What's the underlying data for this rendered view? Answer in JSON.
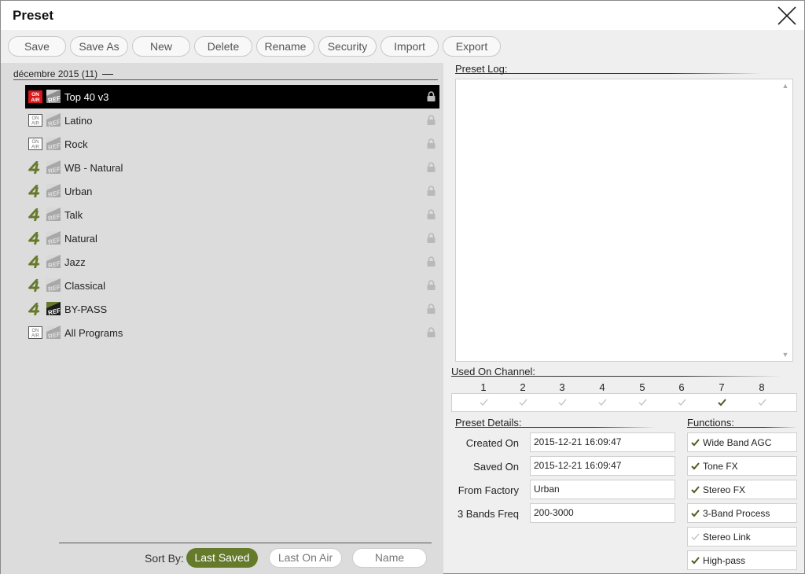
{
  "window": {
    "title": "Preset"
  },
  "toolbar": {
    "buttons": [
      "Save",
      "Save As",
      "New",
      "Delete",
      "Rename",
      "Security",
      "Import",
      "Export"
    ]
  },
  "group": {
    "header": "décembre 2015 (11)"
  },
  "presets": [
    {
      "name": "Top 40 v3",
      "status": "on-air",
      "ref": "ref",
      "selected": true,
      "locked": true
    },
    {
      "name": "Latino",
      "status": "on-air-inactive",
      "ref": "ref-inactive",
      "selected": false,
      "locked": true
    },
    {
      "name": "Rock",
      "status": "on-air-inactive",
      "ref": "ref-inactive",
      "selected": false,
      "locked": true
    },
    {
      "name": "WB - Natural",
      "status": "factory",
      "ref": "ref-inactive",
      "selected": false,
      "locked": true
    },
    {
      "name": "Urban",
      "status": "factory",
      "ref": "ref-inactive",
      "selected": false,
      "locked": true
    },
    {
      "name": "Talk",
      "status": "factory",
      "ref": "ref-inactive",
      "selected": false,
      "locked": true
    },
    {
      "name": "Natural",
      "status": "factory",
      "ref": "ref-inactive",
      "selected": false,
      "locked": true
    },
    {
      "name": "Jazz",
      "status": "factory",
      "ref": "ref-inactive",
      "selected": false,
      "locked": true
    },
    {
      "name": "Classical",
      "status": "factory",
      "ref": "ref-inactive",
      "selected": false,
      "locked": true
    },
    {
      "name": "BY-PASS",
      "status": "factory",
      "ref": "ref-active",
      "selected": false,
      "locked": true
    },
    {
      "name": "All Programs",
      "status": "on-air-inactive",
      "ref": "ref-inactive",
      "selected": false,
      "locked": true
    }
  ],
  "sort": {
    "label": "Sort By:",
    "options": [
      "Last Saved",
      "Last On Air",
      "Name"
    ],
    "active": "Last Saved"
  },
  "log": {
    "label": "Preset Log:"
  },
  "channels": {
    "label": "Used On Channel:",
    "items": [
      {
        "num": "1",
        "used": false
      },
      {
        "num": "2",
        "used": false
      },
      {
        "num": "3",
        "used": false
      },
      {
        "num": "4",
        "used": false
      },
      {
        "num": "5",
        "used": false
      },
      {
        "num": "6",
        "used": false
      },
      {
        "num": "7",
        "used": true
      },
      {
        "num": "8",
        "used": false
      }
    ]
  },
  "details": {
    "label": "Preset Details:",
    "fields": [
      {
        "label": "Created On",
        "value": "2015-12-21 16:09:47"
      },
      {
        "label": "Saved On",
        "value": "2015-12-21 16:09:47"
      },
      {
        "label": "From Factory",
        "value": "Urban"
      },
      {
        "label": "3 Bands Freq",
        "value": "200-3000"
      }
    ]
  },
  "functions": {
    "label": "Functions:",
    "items": [
      {
        "label": "Wide Band AGC",
        "enabled": true
      },
      {
        "label": "Tone FX",
        "enabled": true
      },
      {
        "label": "Stereo FX",
        "enabled": true
      },
      {
        "label": "3-Band Process",
        "enabled": true
      },
      {
        "label": "Stereo Link",
        "enabled": false
      },
      {
        "label": "High-pass",
        "enabled": true
      }
    ]
  },
  "colors": {
    "accent": "#667a2c",
    "check_active": "#4a5d1e",
    "check_inactive": "#c4c4c4",
    "selected_row": "#000000",
    "onair_red": "#d7191c"
  }
}
